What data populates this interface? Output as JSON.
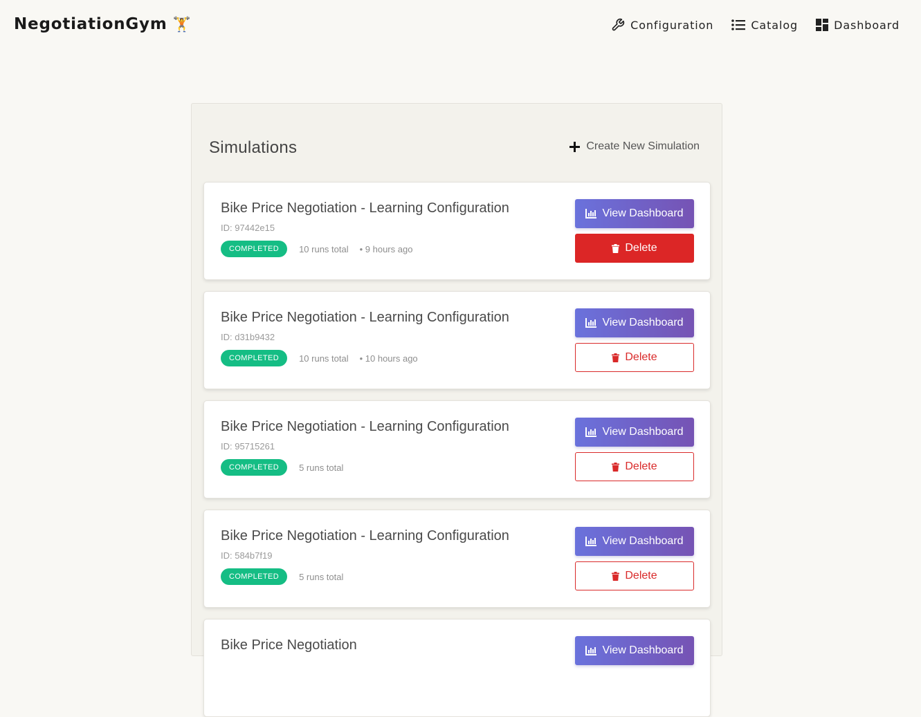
{
  "header": {
    "brand": "NegotiationGym",
    "brand_emoji": "🏋",
    "nav": {
      "configuration": "Configuration",
      "catalog": "Catalog",
      "dashboard": "Dashboard"
    }
  },
  "panel": {
    "title": "Simulations",
    "create_label": "Create New Simulation"
  },
  "simulations": [
    {
      "title": "Bike Price Negotiation - Learning Configuration",
      "id": "ID: 97442e15",
      "status": "COMPLETED",
      "runs": "10 runs total",
      "ago": "• 9 hours ago",
      "view_label": "View Dashboard",
      "delete_label": "Delete"
    },
    {
      "title": "Bike Price Negotiation - Learning Configuration",
      "id": "ID: d31b9432",
      "status": "COMPLETED",
      "runs": "10 runs total",
      "ago": "• 10 hours ago",
      "view_label": "View Dashboard",
      "delete_label": "Delete"
    },
    {
      "title": "Bike Price Negotiation - Learning Configuration",
      "id": "ID: 95715261",
      "status": "COMPLETED",
      "runs": "5 runs total",
      "view_label": "View Dashboard",
      "delete_label": "Delete"
    },
    {
      "title": "Bike Price Negotiation - Learning Configuration",
      "id": "ID: 584b7f19",
      "status": "COMPLETED",
      "runs": "5 runs total",
      "view_label": "View Dashboard",
      "delete_label": "Delete"
    },
    {
      "title": "Bike Price Negotiation",
      "view_label": "View Dashboard"
    }
  ],
  "colors": {
    "background": "#f9f8f4",
    "status_completed": "#15bd84",
    "view_gradient_start": "#6a72dc",
    "view_gradient_end": "#7653b4",
    "delete_red": "#dc2626"
  }
}
